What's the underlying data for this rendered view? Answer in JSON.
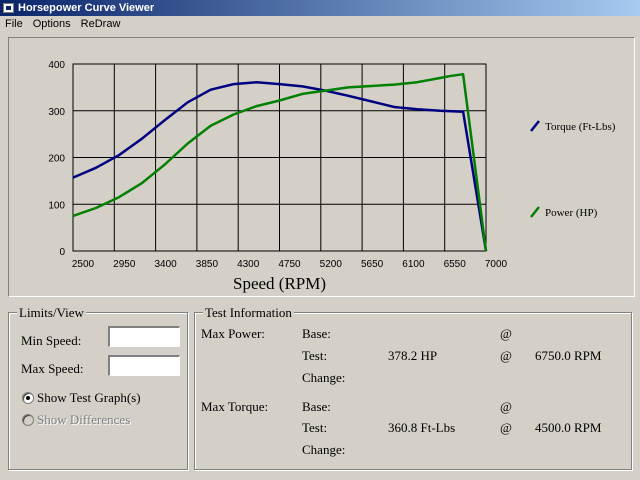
{
  "window": {
    "title": "Horsepower Curve Viewer"
  },
  "menu": {
    "items": [
      "File",
      "Options",
      "ReDraw"
    ]
  },
  "chart_data": {
    "type": "line",
    "xlabel": "Speed (RPM)",
    "ylabel": "",
    "xlim": [
      2500,
      7000
    ],
    "ylim": [
      0,
      400
    ],
    "x_ticks": [
      "2500",
      "2950",
      "3400",
      "3850",
      "4300",
      "4750",
      "5200",
      "5650",
      "6100",
      "6550",
      "7000"
    ],
    "y_ticks": [
      "0",
      "100",
      "200",
      "300",
      "400"
    ],
    "grid": true,
    "legend_position": "right",
    "series": [
      {
        "name": "Torque (Ft-Lbs)",
        "color": "#000080",
        "x": [
          2500,
          2750,
          3000,
          3250,
          3500,
          3750,
          4000,
          4250,
          4500,
          4750,
          5000,
          5250,
          5500,
          5750,
          6000,
          6250,
          6500,
          6750,
          7000
        ],
        "y": [
          157,
          178,
          205,
          240,
          280,
          318,
          345,
          357,
          360.8,
          357,
          352,
          343,
          332,
          320,
          308,
          303,
          300,
          298,
          0
        ]
      },
      {
        "name": "Power (HP)",
        "color": "#008000",
        "x": [
          2500,
          2750,
          3000,
          3250,
          3500,
          3750,
          4000,
          4250,
          4500,
          4750,
          5000,
          5250,
          5500,
          5750,
          6000,
          6250,
          6500,
          6600,
          6750,
          7000
        ],
        "y": [
          75,
          92,
          115,
          145,
          185,
          230,
          268,
          292,
          310,
          322,
          336,
          343,
          350,
          353,
          356,
          361,
          370,
          374,
          378.2,
          0
        ]
      }
    ]
  },
  "limits": {
    "title": "Limits/View",
    "min_speed_label": "Min Speed:",
    "max_speed_label": "Max Speed:",
    "min_speed_value": "",
    "max_speed_value": "",
    "show_test_label": "Show Test Graph(s)",
    "show_diff_label": "Show Differences"
  },
  "test_info": {
    "title": "Test Information",
    "max_power": {
      "label": "Max Power:",
      "base_label": "Base:",
      "test_label": "Test:",
      "change_label": "Change:",
      "base_value": "",
      "base_at": "@",
      "base_rpm": "",
      "test_value": "378.2  HP",
      "test_at": "@",
      "test_rpm": "6750.0  RPM"
    },
    "max_torque": {
      "label": "Max Torque:",
      "base_label": "Base:",
      "test_label": "Test:",
      "change_label": "Change:",
      "base_value": "",
      "base_at": "@",
      "base_rpm": "",
      "test_value": "360.8  Ft-Lbs",
      "test_at": "@",
      "test_rpm": "4500.0  RPM"
    }
  }
}
